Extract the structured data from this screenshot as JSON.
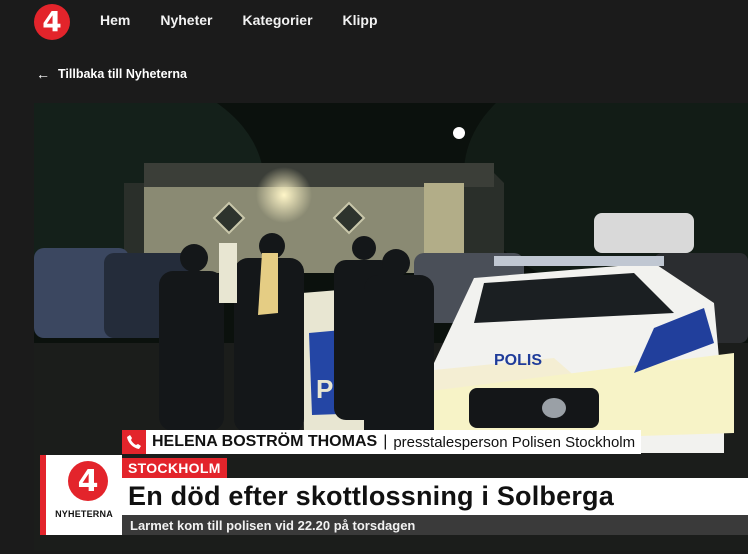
{
  "header": {
    "logo_text": "4",
    "nav": [
      "Hem",
      "Nyheter",
      "Kategorier",
      "Klipp"
    ]
  },
  "back_link": {
    "label": "Tillbaka till Nyheterna"
  },
  "video": {
    "lower_third": {
      "brand_label": "NYHETERNA",
      "logo_text": "4",
      "speaker_name": "HELENA BOSTRÖM THOMAS",
      "separator": "|",
      "speaker_role": "presstalesperson Polisen Stockholm",
      "location": "STOCKHOLM",
      "headline": "En död efter skottlossning i Solberga",
      "subline": "Larmet kom till polisen vid 22.20 på torsdagen"
    },
    "police_car_text": "POLIS",
    "door_text": "PO"
  },
  "colors": {
    "brand_red": "#e3242b",
    "background": "#1b1b1b"
  }
}
